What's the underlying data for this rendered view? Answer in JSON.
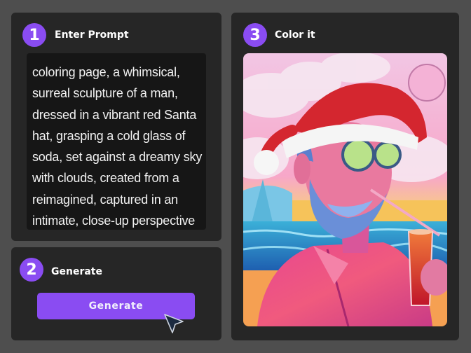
{
  "steps": [
    {
      "number": "1",
      "title": "Enter Prompt"
    },
    {
      "number": "2",
      "title": "Generate"
    },
    {
      "number": "3",
      "title": "Color it"
    }
  ],
  "prompt": {
    "text": "coloring page, a whimsical, surreal sculpture of a man, dressed in a vibrant red Santa hat, grasping a cold glass of soda, set against a dreamy sky with clouds, created from a reimagined, captured in an intimate, close-up perspective"
  },
  "generate": {
    "button_label": "Generate"
  },
  "colors": {
    "accent": "#8a4cf2",
    "panel": "#262626",
    "background": "#4e4e4e",
    "text_area": "#161616"
  }
}
